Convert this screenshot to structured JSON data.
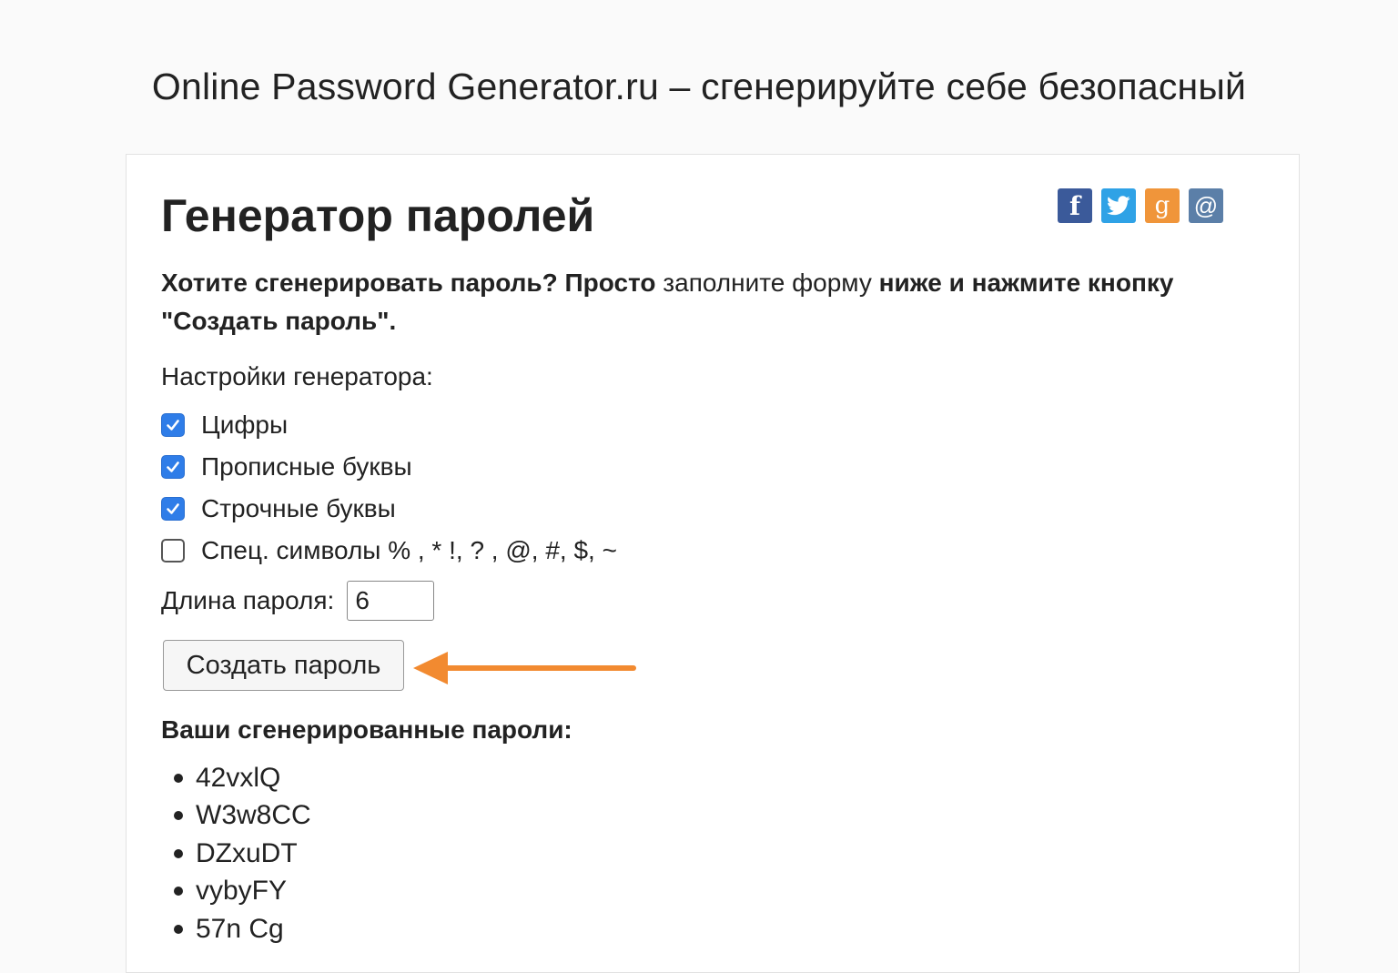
{
  "site": {
    "title": "Online Password Generator.ru – сгенерируйте себе безопасный"
  },
  "panel": {
    "title": "Генератор паролей",
    "social": [
      {
        "name": "facebook",
        "glyph": "f",
        "color": "#3b5a9a"
      },
      {
        "name": "twitter",
        "glyph": "",
        "color": "#2fa2e6"
      },
      {
        "name": "google",
        "glyph": "g",
        "color": "#f0953a"
      },
      {
        "name": "mail",
        "glyph": "@",
        "color": "#5b7fa8"
      }
    ],
    "intro": {
      "part1": "Хотите сгенерировать пароль? Просто",
      "part2": " заполните форму ",
      "part3": "ниже и нажмите кнопку \"Создать пароль\"."
    }
  },
  "settings": {
    "label": "Настройки генератора:",
    "options": [
      {
        "label": "Цифры",
        "checked": true
      },
      {
        "label": "Прописные буквы",
        "checked": true
      },
      {
        "label": "Строчные буквы",
        "checked": true
      },
      {
        "label": "Спец. символы % , * !, ? , @, #, $, ~",
        "checked": false
      }
    ],
    "length_label": "Длина пароля:",
    "length_value": "6",
    "button_label": "Создать пароль",
    "accent_color": "#2f7de8",
    "arrow_color": "#f28a30"
  },
  "results": {
    "title": "Ваши сгенерированные пароли:",
    "passwords": [
      "42vxlQ",
      "W3w8CC",
      "DZxuDT",
      "vybyFY",
      "57n Cg"
    ]
  }
}
